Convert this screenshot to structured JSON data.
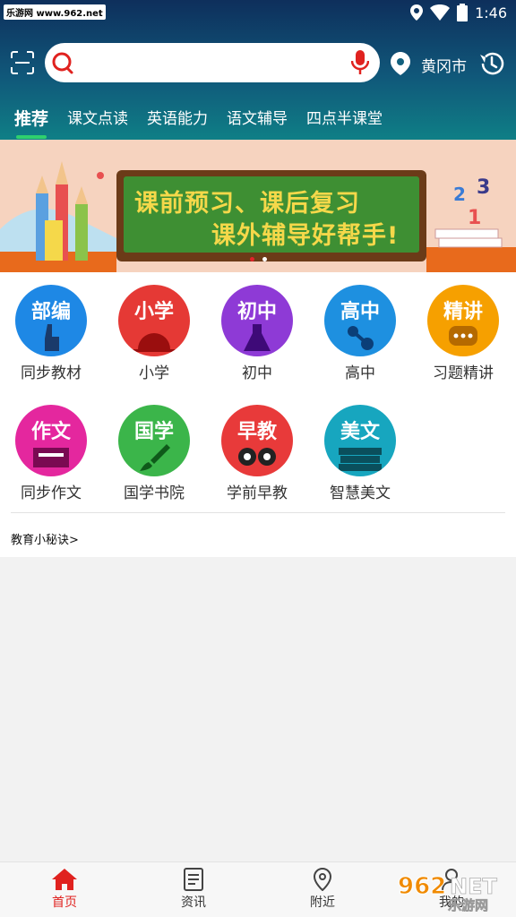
{
  "status": {
    "badge": "乐游网 www.962.net",
    "time": "1:46"
  },
  "search": {
    "placeholder": "",
    "city": "黄冈市"
  },
  "tabs": [
    "推荐",
    "课文点读",
    "英语能力",
    "语文辅导",
    "四点半课堂"
  ],
  "banner": {
    "line1": "课前预习、课后复习",
    "line2": "课外辅导好帮手!"
  },
  "grid": [
    {
      "icon_text": "部编",
      "label": "同步教材",
      "color": "#1e88e5"
    },
    {
      "icon_text": "小学",
      "label": "小学",
      "color": "#e53935"
    },
    {
      "icon_text": "初中",
      "label": "初中",
      "color": "#8e3ad6"
    },
    {
      "icon_text": "高中",
      "label": "高中",
      "color": "#1e90e0"
    },
    {
      "icon_text": "精讲",
      "label": "习题精讲",
      "color": "#f6a000"
    },
    {
      "icon_text": "作文",
      "label": "同步作文",
      "color": "#e4279e"
    },
    {
      "icon_text": "国学",
      "label": "国学书院",
      "color": "#3bb54a"
    },
    {
      "icon_text": "早教",
      "label": "学前早教",
      "color": "#e83a3a"
    },
    {
      "icon_text": "美文",
      "label": "智慧美文",
      "color": "#17a6bf"
    }
  ],
  "tips": "教育小秘诀>",
  "nav": [
    "首页",
    "资讯",
    "附近",
    "我的"
  ],
  "watermark": {
    "brand": "962",
    "suffix": "NET",
    "site": "乐游网"
  }
}
